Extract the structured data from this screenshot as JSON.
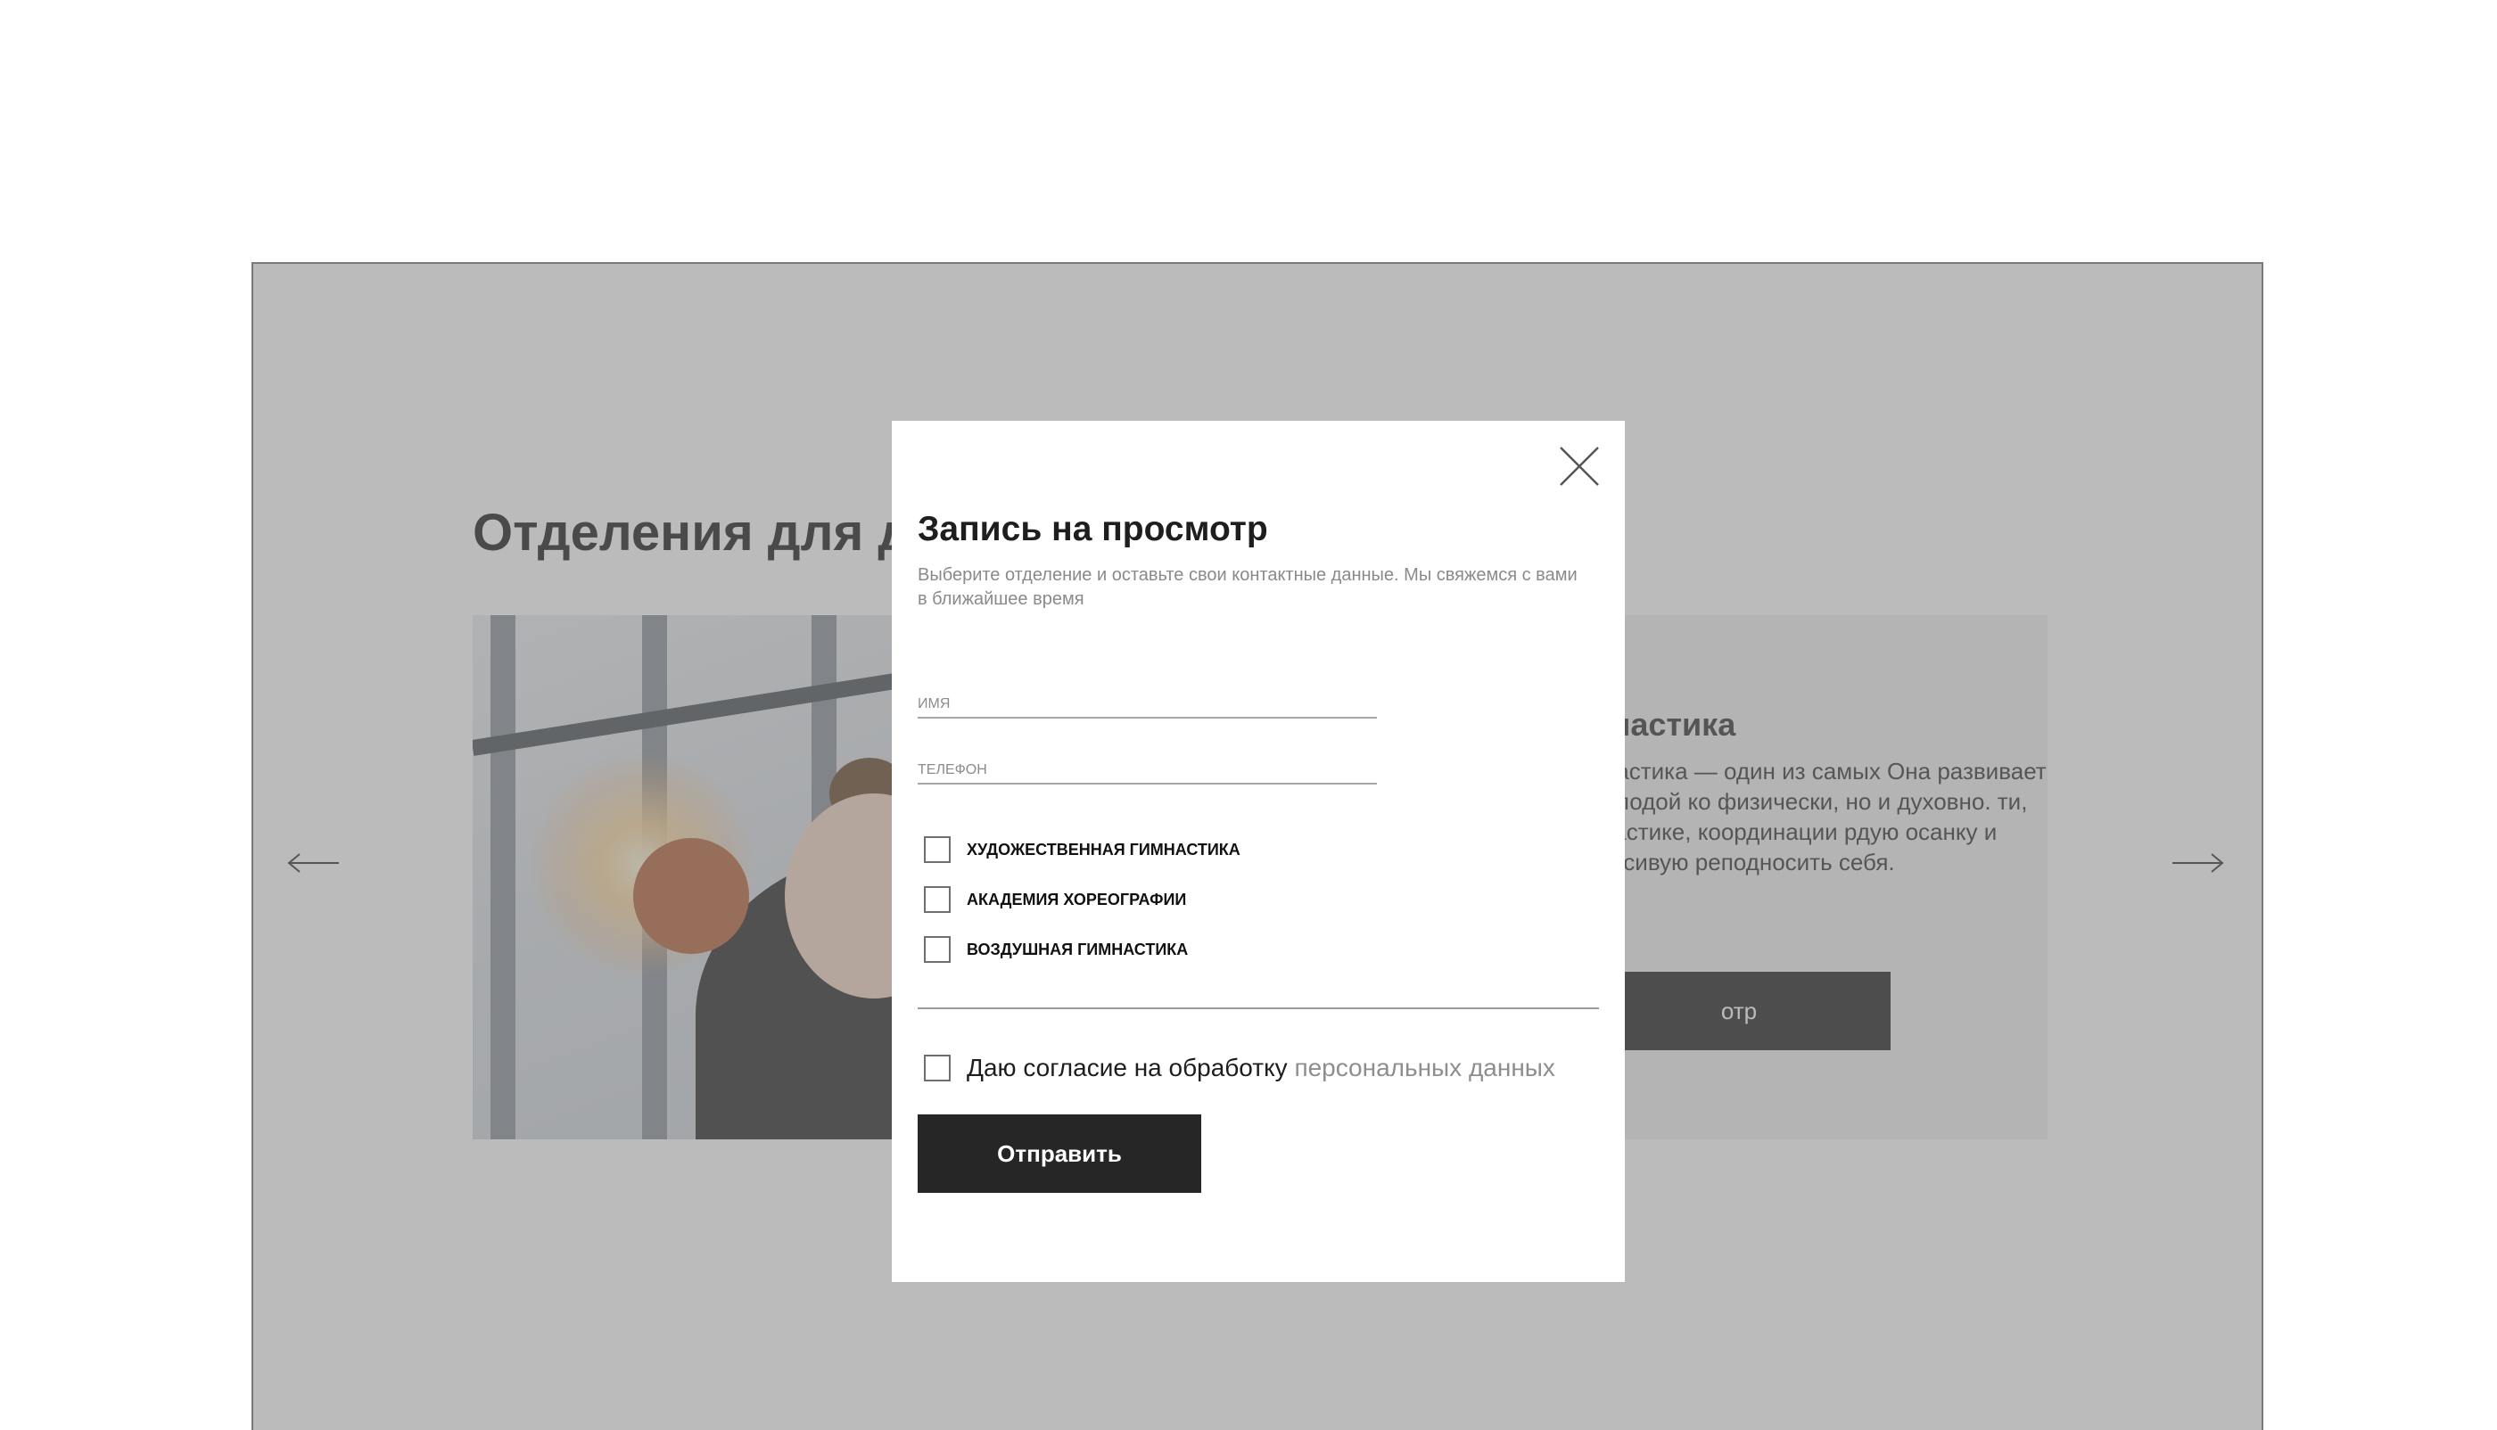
{
  "background": {
    "section_title": "Отделения для д",
    "card": {
      "title": "мнастика",
      "text": "мнастика — один из самых Она развивает молодой ко физически, но и духовно. ти, пластике, координации рдую осанку и красивую реподносить себя.",
      "button_label": "отр"
    },
    "nav": {
      "prev_icon": "arrow-left-icon",
      "next_icon": "arrow-right-icon"
    }
  },
  "modal": {
    "title": "Запись на просмотр",
    "subtitle": "Выберите отделение и оставьте свои контактные данные. Мы свяжемся с вами в ближайшее время",
    "close_icon": "close-icon",
    "fields": {
      "name_placeholder": "имя",
      "phone_placeholder": "телефон"
    },
    "options": [
      {
        "label": "ХУДОЖЕСТВЕННАЯ ГИМНАСТИКА",
        "checked": false
      },
      {
        "label": "АКАДЕМИЯ ХОРЕОГРАФИИ",
        "checked": false
      },
      {
        "label": "ВОЗДУШНАЯ ГИМНАСТИКА",
        "checked": false
      }
    ],
    "consent": {
      "text": "Даю согласие на обработку",
      "link": "персональных данных",
      "checked": false
    },
    "submit_label": "Отправить"
  },
  "colors": {
    "overlay": "#787878",
    "modal_bg": "#ffffff",
    "button_bg": "#262626",
    "muted_text": "#8a8a8a"
  }
}
